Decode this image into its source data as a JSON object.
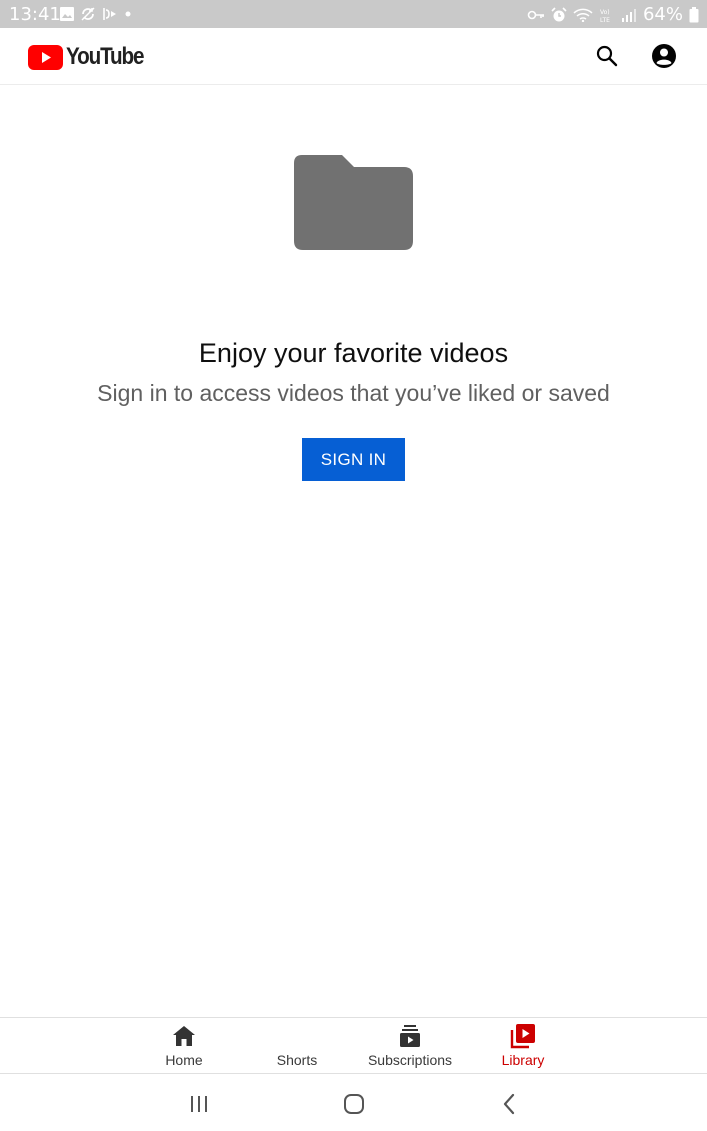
{
  "status_bar": {
    "time": "13:41",
    "battery": "64%",
    "left_icons": [
      "gallery-icon",
      "sync-icon",
      "cast-icon",
      "dot-icon"
    ],
    "right_icons": [
      "key-icon",
      "alarm-icon",
      "wifi-icon",
      "volte-icon",
      "signal-icon",
      "battery-icon"
    ]
  },
  "header": {
    "logo_text": "YouTube",
    "brand_color": "#ff0000",
    "icons": [
      "search-icon",
      "account-icon"
    ]
  },
  "main": {
    "illustration": "folder-icon",
    "title": "Enjoy your favorite videos",
    "subtitle": "Sign in to access videos that you’ve liked or saved",
    "sign_in_label": "SIGN IN",
    "button_color": "#065fd4"
  },
  "bottom_nav": {
    "items": [
      {
        "label": "Home",
        "icon": "home-icon",
        "active": false
      },
      {
        "label": "Shorts",
        "icon": "shorts-icon",
        "active": false
      },
      {
        "label": "Subscriptions",
        "icon": "subscriptions-icon",
        "active": false
      },
      {
        "label": "Library",
        "icon": "library-icon",
        "active": true
      }
    ],
    "active_color": "#cc0000"
  },
  "system_nav": {
    "icons": [
      "recents-icon",
      "home-circle-icon",
      "back-icon"
    ]
  }
}
